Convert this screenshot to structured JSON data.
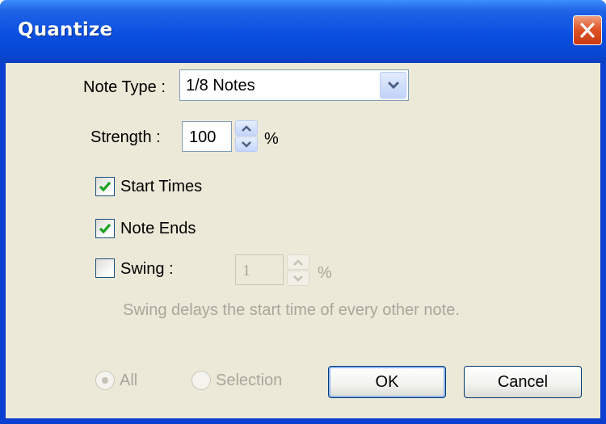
{
  "window": {
    "title": "Quantize"
  },
  "note_type": {
    "label": "Note Type :",
    "value": "1/8 Notes"
  },
  "strength": {
    "label": "Strength :",
    "value": "100",
    "unit": "%"
  },
  "start_times": {
    "label": "Start Times",
    "checked": true
  },
  "note_ends": {
    "label": "Note Ends",
    "checked": true
  },
  "swing": {
    "label": "Swing :",
    "checked": false,
    "value": "1",
    "unit": "%",
    "description": "Swing delays the start time of every other note."
  },
  "scope": {
    "all_label": "All",
    "selection_label": "Selection",
    "selected": "All"
  },
  "buttons": {
    "ok": "OK",
    "cancel": "Cancel"
  },
  "colors": {
    "titlebar": "#0a4fe0",
    "client": "#ece9d8",
    "check": "#21a121",
    "close": "#e0552a"
  }
}
